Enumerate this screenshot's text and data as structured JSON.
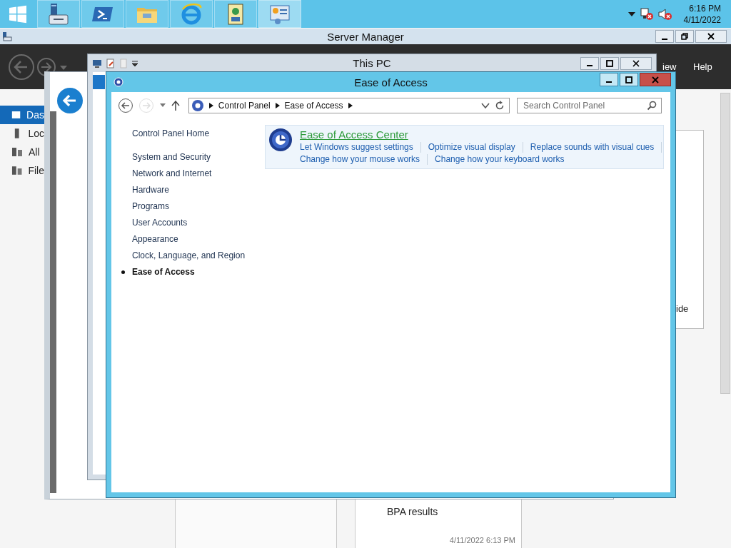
{
  "taskbar": {
    "apps": [
      {
        "kind": "server-manager",
        "selected": false
      },
      {
        "kind": "shell",
        "selected": false
      },
      {
        "kind": "folder",
        "selected": false
      },
      {
        "kind": "browser",
        "selected": false
      },
      {
        "kind": "document",
        "selected": false
      },
      {
        "kind": "control-panel",
        "selected": true
      }
    ],
    "clock": {
      "time": "6:16 PM",
      "date": "4/11/2022"
    }
  },
  "server_manager": {
    "title": "Server Manager",
    "menu": [
      "iew",
      "Help"
    ],
    "sidebar": [
      {
        "label": "Das",
        "selected": true
      },
      {
        "label": "Loc",
        "selected": false
      },
      {
        "label": "All",
        "selected": false
      },
      {
        "label": "File",
        "selected": false
      }
    ],
    "tile_text": "ide",
    "bpa": {
      "title": "BPA results",
      "time": "4/11/2022 6:13 PM"
    }
  },
  "this_pc": {
    "title": "This PC"
  },
  "ease_of_access": {
    "title": "Ease of Access",
    "breadcrumb": [
      "Control Panel",
      "Ease of Access"
    ],
    "search": {
      "placeholder": "Search Control Panel"
    },
    "nav": {
      "home": "Control Panel Home",
      "items": [
        {
          "label": "System and Security",
          "selected": false
        },
        {
          "label": "Network and Internet",
          "selected": false
        },
        {
          "label": "Hardware",
          "selected": false
        },
        {
          "label": "Programs",
          "selected": false
        },
        {
          "label": "User Accounts",
          "selected": false
        },
        {
          "label": "Appearance",
          "selected": false
        },
        {
          "label": "Clock, Language, and Region",
          "selected": false
        },
        {
          "label": "Ease of Access",
          "selected": true
        }
      ]
    },
    "category": {
      "title": "Ease of Access Center",
      "links": [
        [
          "Let Windows suggest settings",
          "Optimize visual display",
          "Replace sounds with visual cues"
        ],
        [
          "Change how your mouse works",
          "Change how your keyboard works"
        ]
      ]
    }
  }
}
